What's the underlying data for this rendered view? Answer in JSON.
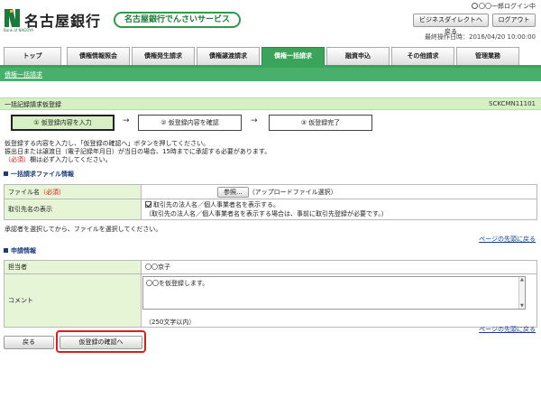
{
  "header": {
    "bank_name": "名古屋銀行",
    "logo_sub": "Bank of NAGOYA",
    "service_name": "名古屋銀行でんさいサービス",
    "login_user": "〇〇一郎ログイン中",
    "direct_button": "ビジネスダイレクトへ戻る",
    "logout_button": "ログアウト",
    "last_operation": "最終操作日時：2016/04/20 10:00:00",
    "brand_color": "#3aa55a"
  },
  "nav": {
    "tabs": [
      {
        "label": "トップ",
        "active": false
      },
      {
        "label": "債権情報照会",
        "active": false
      },
      {
        "label": "債権発生請求",
        "active": false
      },
      {
        "label": "債権譲渡請求",
        "active": false
      },
      {
        "label": "債権一括請求",
        "active": true
      },
      {
        "label": "融資申込",
        "active": false
      },
      {
        "label": "その他請求",
        "active": false
      },
      {
        "label": "管理業務",
        "active": false
      }
    ],
    "subnav_link": "債権一括請求"
  },
  "page": {
    "title": "一括記録請求仮登録",
    "screen_id": "SCKCMN11101"
  },
  "steps": [
    {
      "label": "① 仮登録内容を入力",
      "active": true
    },
    {
      "label": "② 仮登録内容を確認",
      "active": false
    },
    {
      "label": "③ 仮登録完了",
      "active": false
    }
  ],
  "instructions": {
    "line1": "仮登録する内容を入力し、「仮登録の確認へ」ボタンを押してください。",
    "line2": "振出日または譲渡日（電子記録年月日）が当日の場合、15時までに承認する必要があります。",
    "required_mark": "（必須）",
    "line3_suffix": "欄は必ず入力してください。"
  },
  "file_section": {
    "heading": "一括請求ファイル情報",
    "file_label": "ファイル名",
    "file_required": "（必須）",
    "browse_button": "参照...",
    "file_note": "（アップロードファイル選択）",
    "display_label": "取引先名の表示",
    "checkbox_label": "取引先の法人名／個人事業者名を表示する。",
    "checkbox_note": "（取引先の法人名／個人事業者名を表示する場合は、事前に取引先登録が必要です。）",
    "after_note": "承認者を選択してから、ファイルを選択してください。",
    "page_top": "ページの先頭に戻る"
  },
  "request_section": {
    "heading": "申請情報",
    "person_label": "担当者",
    "person_value": "〇〇京子",
    "comment_label": "コメント",
    "comment_value": "〇〇を仮登録します。",
    "comment_limit": "（250文字以内）",
    "page_top": "ページの先頭に戻る"
  },
  "actions": {
    "back_button": "戻る",
    "confirm_button": "仮登録の確認へ",
    "highlight_color": "#e01b1b"
  }
}
